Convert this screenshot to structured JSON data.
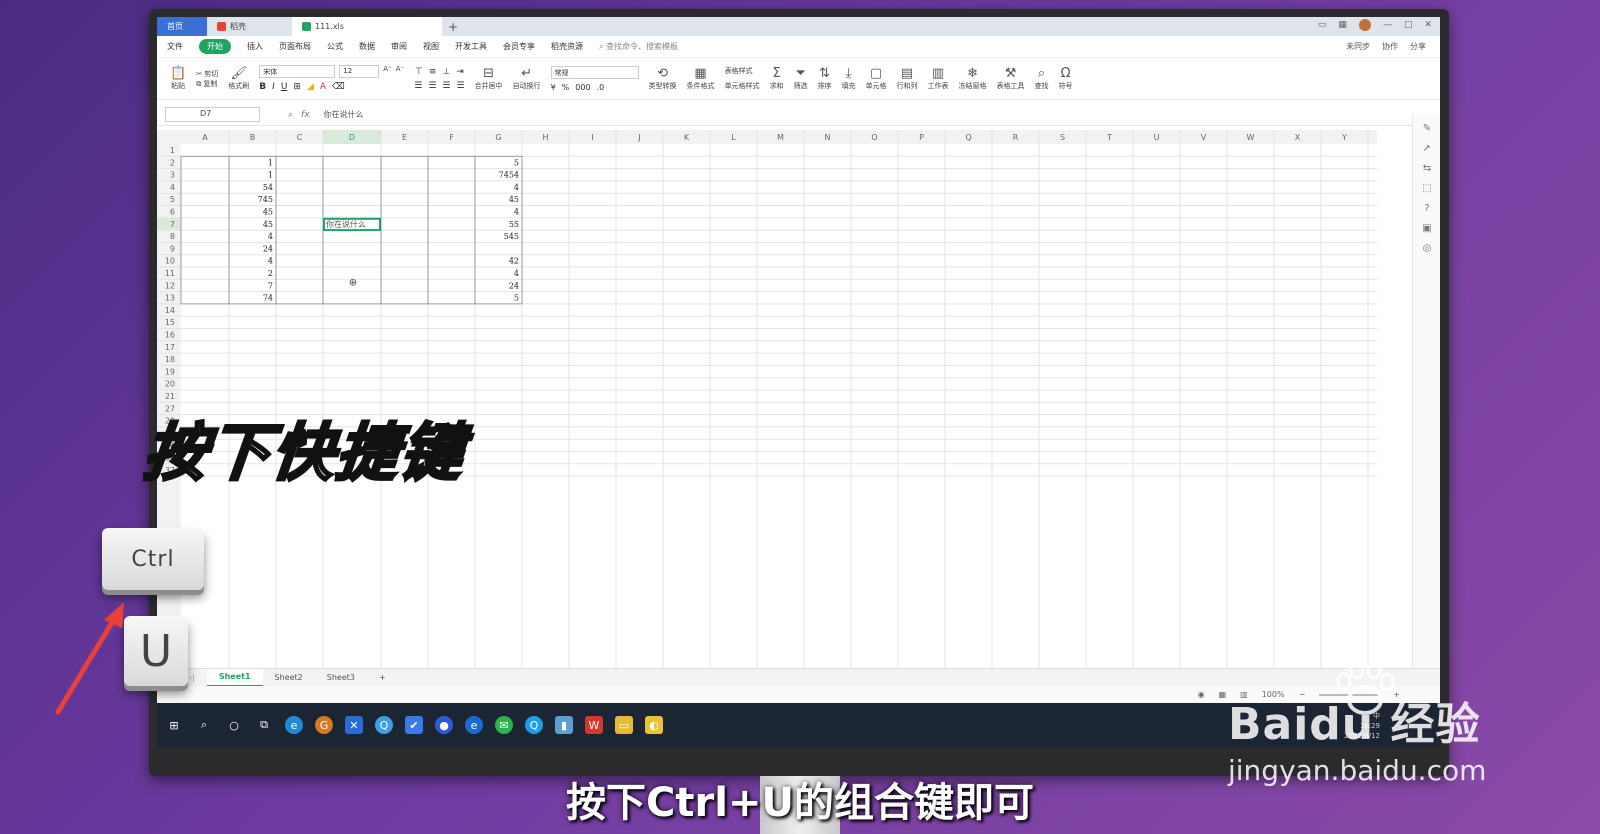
{
  "tabs": {
    "home": "首页",
    "docer": "稻壳",
    "file": "111.xls"
  },
  "menu": [
    "文件",
    "开始",
    "插入",
    "页面布局",
    "公式",
    "数据",
    "审阅",
    "视图",
    "开发工具",
    "会员专享",
    "稻壳资源"
  ],
  "menu_search": "查找命令、搜索模板",
  "menu_right": [
    "未同步",
    "协作",
    "分享"
  ],
  "ribbon": {
    "paste": "粘贴",
    "cut": "剪切",
    "copy": "复制",
    "format_painter": "格式刷",
    "font_name": "宋体",
    "font_size": "12",
    "merge": "合并居中",
    "wrap": "自动换行",
    "number_format": "常规",
    "convert": "类型转换",
    "cond_format": "条件格式",
    "table_style": "表格样式",
    "cell_style": "单元格样式",
    "sum": "求和",
    "filter": "筛选",
    "sort": "排序",
    "fill": "填充",
    "cell": "单元格",
    "rowcol": "行和列",
    "sheet": "工作表",
    "freeze": "冻结窗格",
    "table_tools": "表格工具",
    "find": "查找",
    "symbol": "符号"
  },
  "formula_bar": {
    "cell_ref": "D7",
    "fx": "fx",
    "content": "你在说什么"
  },
  "grid": {
    "columns": [
      "A",
      "B",
      "C",
      "D",
      "E",
      "F",
      "G",
      "H",
      "I",
      "J",
      "K",
      "L",
      "M",
      "N",
      "O",
      "P",
      "Q",
      "R",
      "S",
      "T",
      "U",
      "V",
      "W",
      "X",
      "Y"
    ],
    "row_numbers": [
      "1",
      "2",
      "3",
      "4",
      "5",
      "6",
      "7",
      "8",
      "9",
      "10",
      "11",
      "12",
      "13",
      "14",
      "15",
      "16",
      "17",
      "18",
      "19",
      "20",
      "21",
      "27",
      "28",
      "29",
      "30",
      "36",
      "37"
    ],
    "col_b": [
      "",
      "1",
      "1",
      "54",
      "745",
      "45",
      "45",
      "4",
      "24",
      "4",
      "2",
      "7",
      "74"
    ],
    "col_g": [
      "",
      "5",
      "7454",
      "4",
      "45",
      "4",
      "55",
      "545",
      "",
      "42",
      "4",
      "24",
      "5"
    ],
    "active_cell_text": "你在说什么"
  },
  "sheets": [
    "Sheet1",
    "Sheet2",
    "Sheet3"
  ],
  "status": {
    "zoom": "100%"
  },
  "tray": {
    "time": "16:29",
    "date": "2022/9/12",
    "lang": "中"
  },
  "overlay": {
    "title": "按下快捷键",
    "key_ctrl": "Ctrl",
    "key_u": "U",
    "caption": "按下Ctrl+U的组合键即可"
  },
  "watermark": {
    "logo": "Baidu 经验",
    "url": "jingyan.baidu.com"
  },
  "colors": {
    "accent": "#1fa463",
    "background": "#6d3aa0",
    "arrow": "#e8413a"
  }
}
